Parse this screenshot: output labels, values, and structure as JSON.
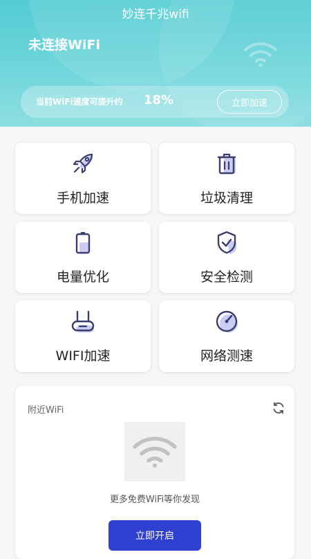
{
  "header": {
    "app_title": "妙连千兆wifi",
    "status": "未连接WiFi",
    "speed_label": "当前WiFi速度可提升约",
    "speed_percent": "18%",
    "speed_button": "立即加速",
    "wifi_icon": "wifi-icon"
  },
  "tiles": [
    {
      "label": "手机加速",
      "icon": "rocket-icon"
    },
    {
      "label": "垃圾清理",
      "icon": "trash-icon"
    },
    {
      "label": "电量优化",
      "icon": "battery-icon"
    },
    {
      "label": "安全检测",
      "icon": "shield-check-icon"
    },
    {
      "label": "WIFI加速",
      "icon": "router-icon"
    },
    {
      "label": "网络测速",
      "icon": "speedometer-icon"
    }
  ],
  "nearby": {
    "title": "附近WiFi",
    "refresh_icon": "refresh-icon",
    "empty_text": "更多免费WiFi等你发现",
    "button": "立即开启"
  },
  "colors": {
    "header_teal": "#52ccd3",
    "accent_blue": "#2f3fd0",
    "icon_dark": "#3a3d6e",
    "icon_light": "#c9cdf3"
  }
}
